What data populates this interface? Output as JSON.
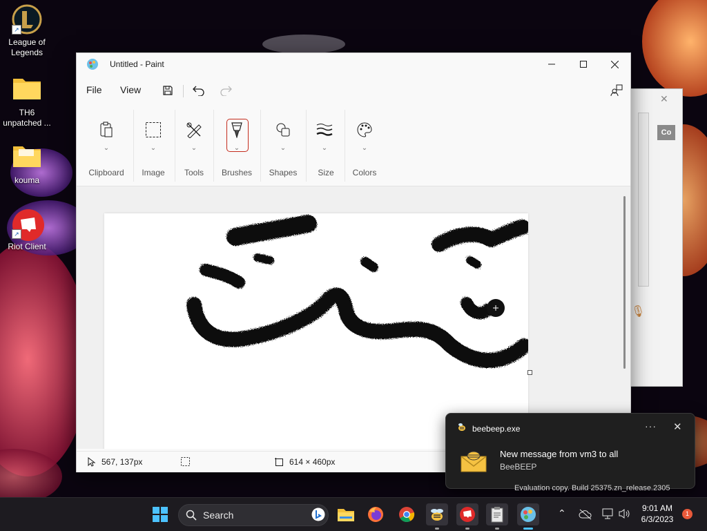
{
  "desktop": {
    "icons": [
      {
        "label": "League of Legends",
        "icon": "league-of-legends-icon"
      },
      {
        "label": "TH6 unpatched ...",
        "icon": "folder-icon"
      },
      {
        "label": "kouma",
        "icon": "folder-icon"
      },
      {
        "label": "Riot Client",
        "icon": "riot-client-icon"
      }
    ]
  },
  "background_window": {
    "text": "Co"
  },
  "paint": {
    "title": "Untitled - Paint",
    "menu": {
      "file": "File",
      "view": "View"
    },
    "quick_icons": [
      "save-icon",
      "undo-icon",
      "redo-icon"
    ],
    "ribbon_groups": [
      "Clipboard",
      "Image",
      "Tools",
      "Brushes",
      "Shapes",
      "Size",
      "Colors"
    ],
    "active_group": "Brushes",
    "status": {
      "cursor_position": "567, 137px",
      "canvas_size": "614 × 460px"
    }
  },
  "notification": {
    "app": "beebeep.exe",
    "more": "···",
    "title": "New message from vm3 to all",
    "sender": "BeeBEEP"
  },
  "watermark": "Evaluation copy. Build 25375.zn_release.2305",
  "taskbar": {
    "search_label": "Search",
    "apps": [
      "start-icon",
      "search-icon",
      "bing-icon",
      "file-explorer-icon",
      "firefox-icon",
      "chrome-icon",
      "beebeep-icon",
      "riot-client-icon",
      "notepad-icon",
      "paint-icon"
    ],
    "time": "9:01 AM",
    "date": "6/3/2023",
    "notification_count": "1"
  },
  "colors": {
    "accent": "#c42b1c",
    "taskbar": "#1d1b20",
    "toast_bg": "#1f1f1f"
  }
}
